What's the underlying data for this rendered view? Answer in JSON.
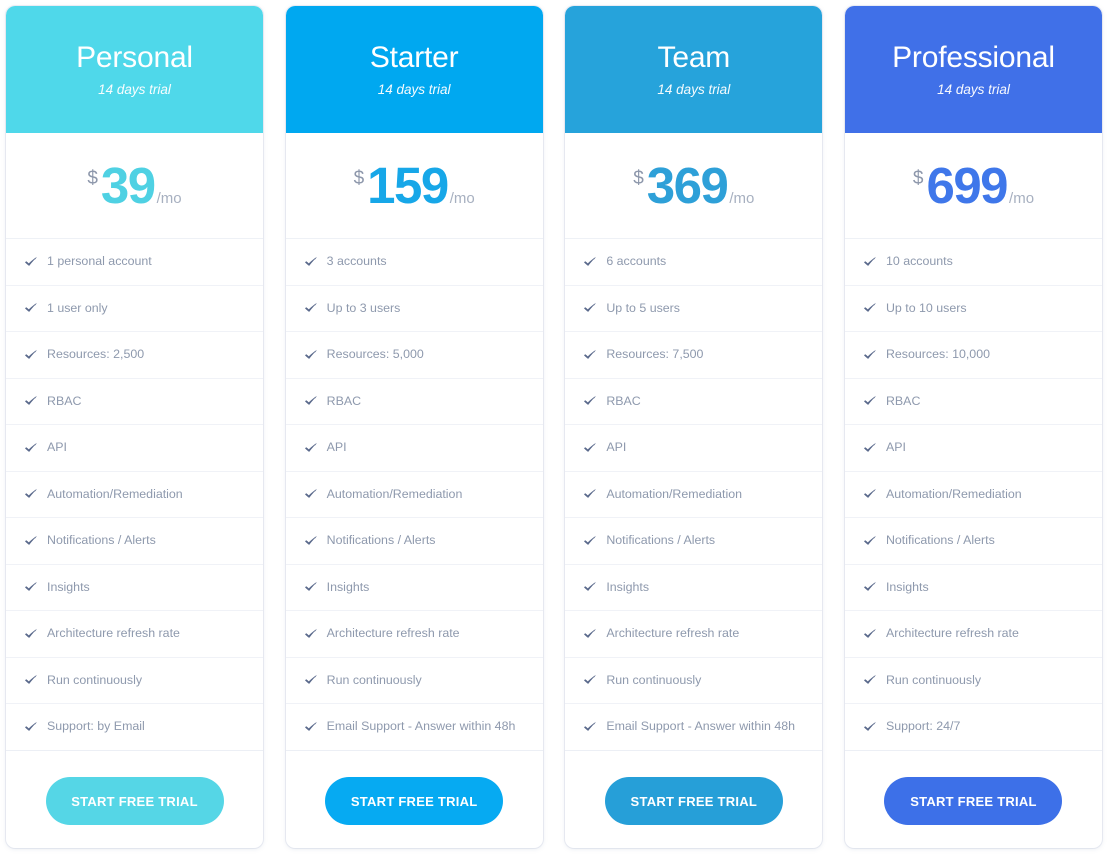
{
  "page": {
    "background": "#ffffff",
    "cta_label": "START FREE TRIAL",
    "currency_symbol": "$",
    "period_label": "/mo",
    "check_icon": "check-icon"
  },
  "plans": [
    {
      "name": "Personal",
      "trial": "14 days trial",
      "price": "39",
      "currency": "$",
      "period": "/mo",
      "header_color": "#4fd8ea",
      "accent_color": "#4fd1e3",
      "button_color": "#55d6e6",
      "cta": "START FREE TRIAL",
      "features": [
        "1 personal account",
        "1 user only",
        "Resources: 2,500",
        "RBAC",
        "API",
        "Automation/Remediation",
        "Notifications / Alerts",
        "Insights",
        "Architecture refresh rate",
        "Run continuously",
        "Support: by Email"
      ]
    },
    {
      "name": "Starter",
      "trial": "14 days trial",
      "price": "159",
      "currency": "$",
      "period": "/mo",
      "header_color": "#00a8f0",
      "accent_color": "#17a7e8",
      "button_color": "#06aaf2",
      "cta": "START FREE TRIAL",
      "features": [
        "3 accounts",
        "Up to 3 users",
        "Resources: 5,000",
        "RBAC",
        "API",
        "Automation/Remediation",
        "Notifications / Alerts",
        "Insights",
        "Architecture refresh rate",
        "Run continuously",
        "Email Support - Answer within 48h"
      ]
    },
    {
      "name": "Team",
      "trial": "14 days trial",
      "price": "369",
      "currency": "$",
      "period": "/mo",
      "header_color": "#26a3db",
      "accent_color": "#2ea0d8",
      "button_color": "#269fd8",
      "cta": "START FREE TRIAL",
      "features": [
        "6 accounts",
        "Up to 5 users",
        "Resources: 7,500",
        "RBAC",
        "API",
        "Automation/Remediation",
        "Notifications / Alerts",
        "Insights",
        "Architecture refresh rate",
        "Run continuously",
        "Email Support - Answer within 48h"
      ]
    },
    {
      "name": "Professional",
      "trial": "14 days trial",
      "price": "699",
      "currency": "$",
      "period": "/mo",
      "header_color": "#4070e8",
      "accent_color": "#3f77ea",
      "button_color": "#3d70e8",
      "cta": "START FREE TRIAL",
      "features": [
        "10 accounts",
        "Up to 10 users",
        "Resources: 10,000",
        "RBAC",
        "API",
        "Automation/Remediation",
        "Notifications / Alerts",
        "Insights",
        "Architecture refresh rate",
        "Run continuously",
        "Support: 24/7"
      ]
    }
  ]
}
